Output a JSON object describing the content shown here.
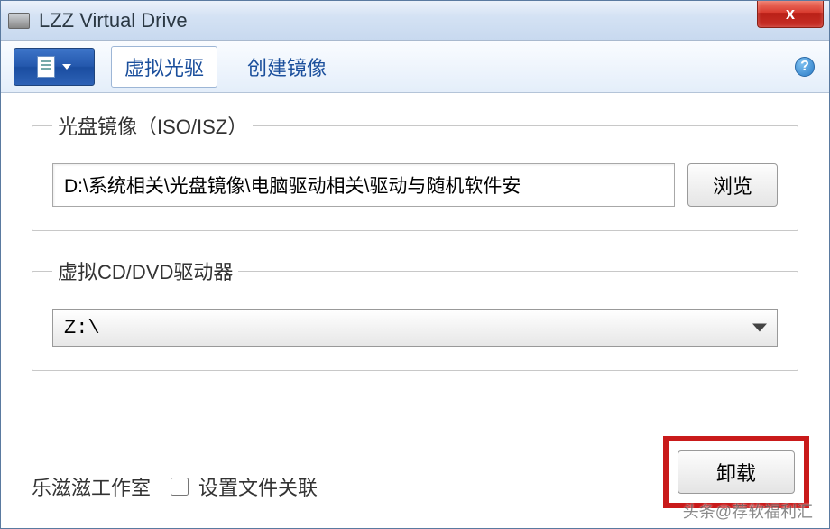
{
  "window": {
    "title": "LZZ Virtual Drive",
    "close_glyph": "x"
  },
  "toolbar": {
    "tab_virtual_drive": "虚拟光驱",
    "tab_create_image": "创建镜像",
    "help_glyph": "?"
  },
  "iso_group": {
    "legend": "光盘镜像（ISO/ISZ）",
    "path_value": "D:\\系统相关\\光盘镜像\\电脑驱动相关\\驱动与随机软件安",
    "browse_label": "浏览"
  },
  "drive_group": {
    "legend": "虚拟CD/DVD驱动器",
    "selected": "Z:\\"
  },
  "footer": {
    "studio": "乐滋滋工作室",
    "assoc_label": "设置文件关联",
    "assoc_checked": false,
    "unload_label": "卸载"
  },
  "watermark": "头条@荐软福利汇"
}
